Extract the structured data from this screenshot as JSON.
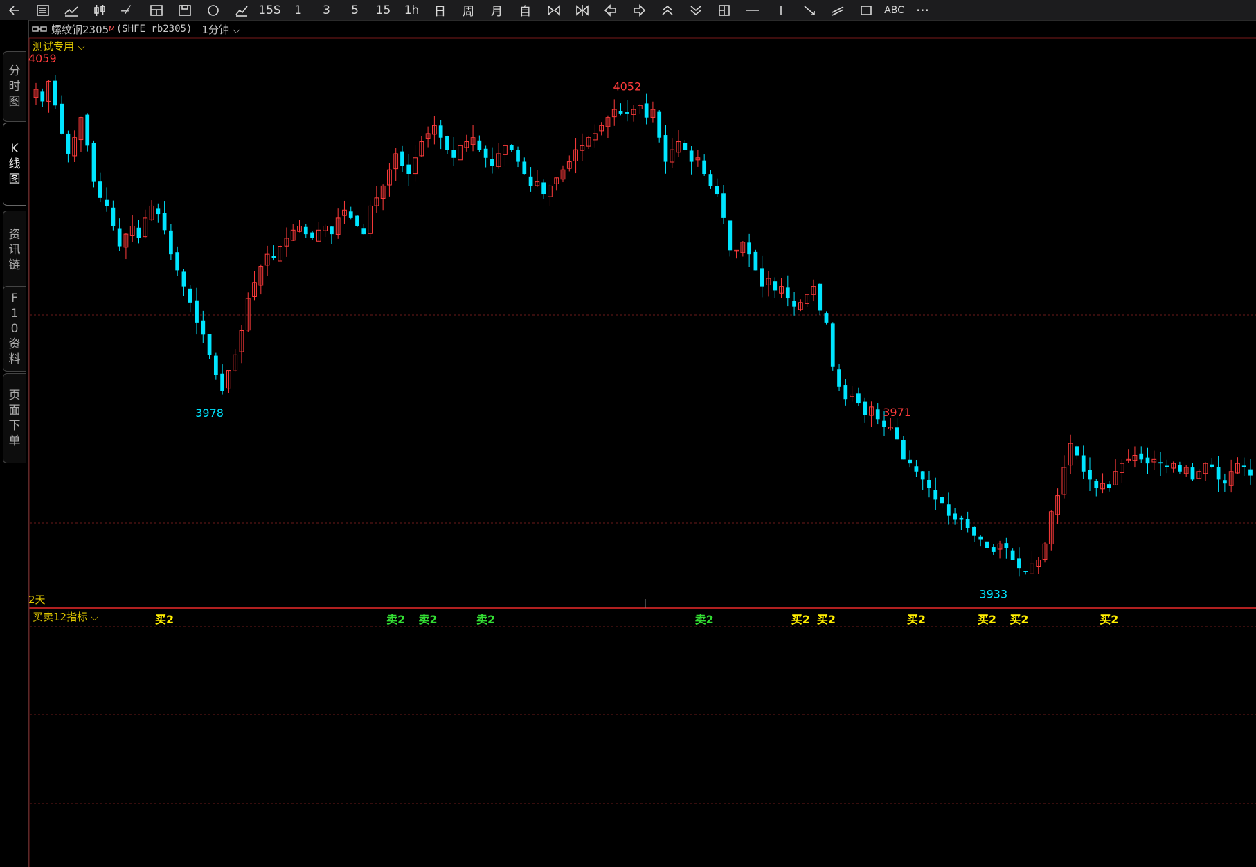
{
  "toolbar": {
    "icons": [
      "back-arrow-icon",
      "list-icon",
      "line-chart-icon",
      "candlestick-icon",
      "drawing-tool-icon",
      "chart-grid-icon",
      "save-icon",
      "circle-icon",
      "fib-icon",
      "period-15s-icon",
      "period-1-icon",
      "period-3-icon",
      "period-5-icon",
      "period-15-icon",
      "period-1h-icon",
      "period-day-icon",
      "period-week-icon",
      "period-month-icon",
      "custom-icon",
      "zoom-in-icon",
      "zoom-out-icon",
      "arrow-left-icon",
      "arrow-right-icon",
      "chevron-up-double-icon",
      "chevron-down-double-icon",
      "layout-icon",
      "horizontal-line-icon",
      "vertical-line-icon",
      "ray-icon",
      "parallel-line-icon",
      "rectangle-icon",
      "text-tool-icon",
      "more-icon"
    ],
    "labels": {
      "p15s": "15S",
      "p1": "1",
      "p3": "3",
      "p5": "5",
      "p15": "15",
      "p1h": "1h",
      "pday": "日",
      "pweek": "周",
      "pmonth": "月",
      "pcustom": "自",
      "text": "ABC",
      "more": "···"
    }
  },
  "sidebar": {
    "tabs": [
      {
        "label": "分时图"
      },
      {
        "label": "K线图"
      },
      {
        "label": "资讯链"
      },
      {
        "label": "F10资料"
      },
      {
        "label": "页面下单"
      }
    ],
    "active": 1
  },
  "header": {
    "name": "螺纹钢2305",
    "sup": "M",
    "code": "(SHFE rb2305)",
    "period": "1分钟"
  },
  "main_panel": {
    "indicator": "测试专用",
    "bottom_label": "2天"
  },
  "sub_panel": {
    "indicator": "买卖12指标"
  },
  "colors": {
    "up": "#ff3b3b",
    "down": "#00e5ff",
    "grid": "#6b1a1a",
    "buy": "#ffee00",
    "sell": "#33dd33",
    "label_yellow": "#e0c800"
  },
  "chart_data": {
    "type": "candlestick",
    "markers": {
      "high1": "4059",
      "high2": "4052",
      "low1": "3978",
      "low2": "3933",
      "high3": "3971"
    },
    "signals": [
      {
        "idx": 20,
        "label": "买2"
      },
      {
        "idx": 56,
        "label": "卖2"
      },
      {
        "idx": 61,
        "label": "卖2"
      },
      {
        "idx": 70,
        "label": "卖2"
      },
      {
        "idx": 104,
        "label": "卖2"
      },
      {
        "idx": 119,
        "label": "买2"
      },
      {
        "idx": 123,
        "label": "买2"
      },
      {
        "idx": 137,
        "label": "买2"
      },
      {
        "idx": 148,
        "label": "买2"
      },
      {
        "idx": 153,
        "label": "买2"
      },
      {
        "idx": 167,
        "label": "买2"
      }
    ],
    "closes": [
      4055,
      4052,
      4057,
      4051,
      4044,
      4039,
      4043,
      4048,
      4041,
      4032,
      4028,
      4026,
      4021,
      4016,
      4019,
      4021,
      4018,
      4023,
      4026,
      4024,
      4020,
      4014,
      4010,
      4006,
      4002,
      3997,
      3994,
      3989,
      3984,
      3980,
      3985,
      3989,
      3995,
      4003,
      4007,
      4011,
      4014,
      4013,
      4016,
      4018,
      4020,
      4021,
      4019,
      4018,
      4020,
      4021,
      4019,
      4023,
      4025,
      4023,
      4021,
      4019,
      4026,
      4028,
      4031,
      4035,
      4039,
      4036,
      4034,
      4038,
      4042,
      4044,
      4046,
      4043,
      4040,
      4038,
      4041,
      4042,
      4043,
      4040,
      4038,
      4036,
      4039,
      4041,
      4040,
      4037,
      4034,
      4031,
      4032,
      4029,
      4031,
      4033,
      4035,
      4037,
      4040,
      4041,
      4043,
      4044,
      4046,
      4048,
      4050,
      4049,
      4049,
      4050,
      4051,
      4048,
      4050,
      4043,
      4037,
      4040,
      4042,
      4040,
      4037,
      4038,
      4034,
      4031,
      4029,
      4023,
      4015,
      4015,
      4017,
      4014,
      4010,
      4006,
      4008,
      4005,
      4006,
      4003,
      4001,
      4002,
      4004,
      4006,
      4000,
      3997,
      3986,
      3981,
      3978,
      3979,
      3977,
      3974,
      3976,
      3973,
      3971,
      3971,
      3968,
      3963,
      3962,
      3960,
      3958,
      3956,
      3953,
      3952,
      3949,
      3948,
      3948,
      3946,
      3944,
      3943,
      3941,
      3940,
      3942,
      3941,
      3938,
      3936,
      3935,
      3937,
      3938,
      3942,
      3950,
      3954,
      3961,
      3967,
      3964,
      3960,
      3958,
      3956,
      3957,
      3956,
      3960,
      3962,
      3963,
      3964,
      3963,
      3962,
      3963,
      3962,
      3961,
      3962,
      3960,
      3961,
      3958,
      3960,
      3962,
      3961,
      3958,
      3957,
      3960,
      3962,
      3961,
      3959
    ]
  }
}
